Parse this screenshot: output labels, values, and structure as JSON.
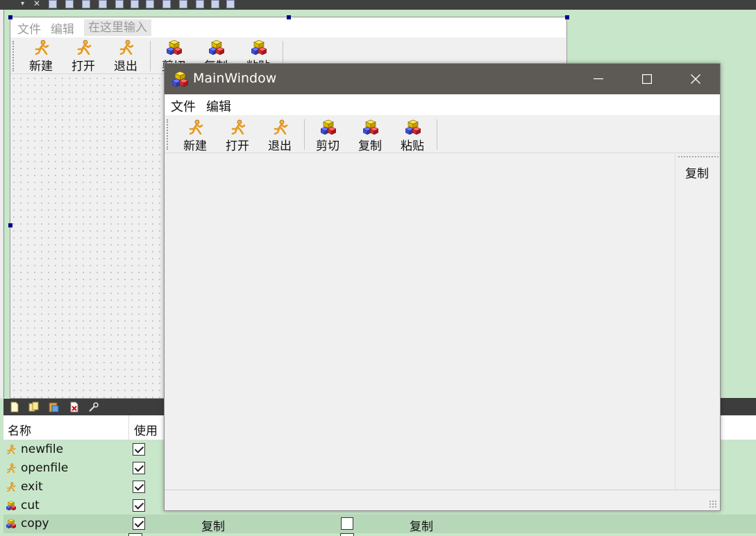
{
  "form": {
    "menu": [
      "文件",
      "编辑"
    ],
    "menu_placeholder": "在这里输入",
    "toolbar": [
      "新建",
      "打开",
      "退出",
      "剪切",
      "复制",
      "粘贴"
    ]
  },
  "main_window": {
    "title": "MainWindow",
    "menu": [
      "文件",
      "编辑"
    ],
    "toolbar": [
      {
        "label": "新建",
        "icon": "running-man-icon"
      },
      {
        "label": "打开",
        "icon": "running-man-icon"
      },
      {
        "label": "退出",
        "icon": "running-man-icon"
      },
      {
        "label": "剪切",
        "icon": "cubes-icon"
      },
      {
        "label": "复制",
        "icon": "cubes-icon"
      },
      {
        "label": "粘贴",
        "icon": "cubes-icon"
      }
    ],
    "dock_text": "复制"
  },
  "action_editor": {
    "headers": {
      "name": "名称",
      "used": "使用"
    },
    "rows": [
      {
        "name": "newfile",
        "used": true,
        "icon": "running-man-icon"
      },
      {
        "name": "openfile",
        "used": true,
        "icon": "running-man-icon"
      },
      {
        "name": "exit",
        "used": true,
        "icon": "running-man-icon"
      },
      {
        "name": "cut",
        "used": true,
        "icon": "cubes-icon"
      },
      {
        "name": "copy",
        "used": true,
        "icon": "cubes-icon",
        "text": "复制",
        "checkable": false,
        "tooltip": "复制"
      }
    ]
  },
  "colors": {
    "accent_bg": "#c8e6c9",
    "titlebar": "#5d5955",
    "selected_row": "#b7d7b9"
  }
}
